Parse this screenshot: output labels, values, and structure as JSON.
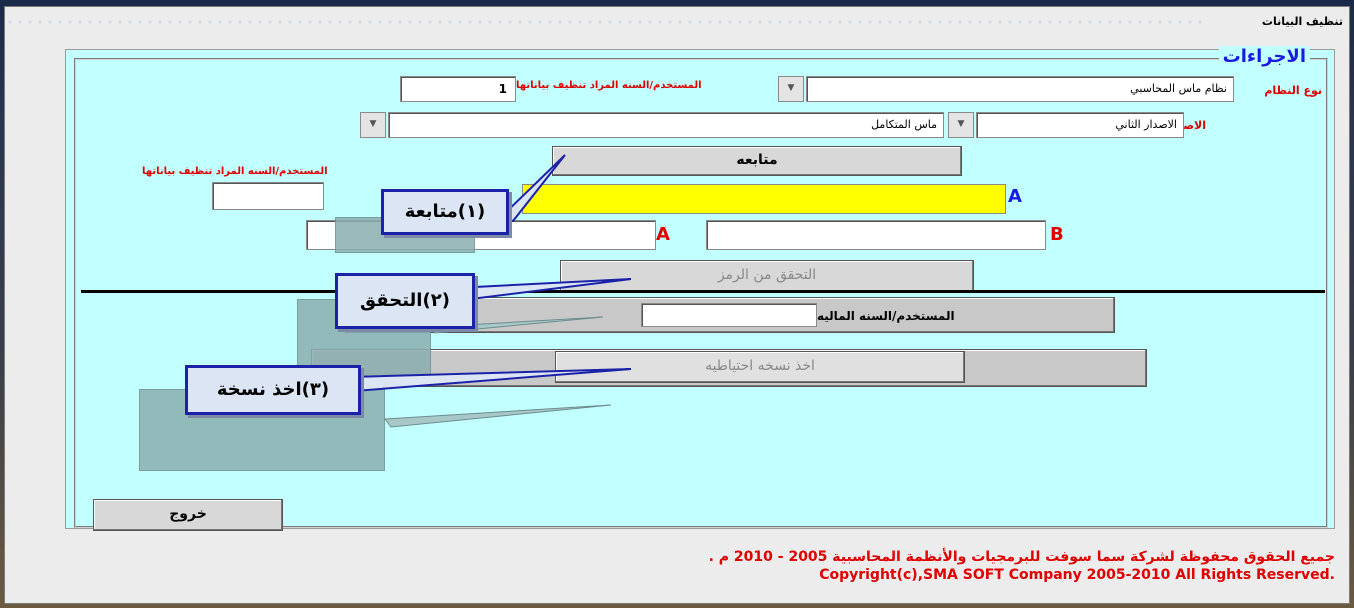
{
  "window": {
    "title": "تنظيف البيانات"
  },
  "procedures": {
    "title": "الاجراءات",
    "system_type_label": "نوع النظام",
    "system_type_value": "نظام ماس المحاسبي",
    "user_year_label": "المستخدم/السنه المراد تنظيف بياناتها",
    "user_year_value": "1",
    "version_label": "الاصدار",
    "version_value": "الاصدار الثاني",
    "edition_value": "ماس المتكامل",
    "continue_button": "متابعه",
    "user_year_label_2": "المستخدم/السنه المراد تنظيف بياناتها",
    "verify_button": "التحقق من الرمز",
    "user_fin_year_label": "المستخدم/السنه الماليه",
    "backup_button": "اخذ نسخه احتياطيه",
    "exit_button": "خروج",
    "letter_a": "A",
    "letter_b": "B"
  },
  "callouts": {
    "step1": "(١)متابعة",
    "step2": "(٢)التحقق",
    "step3": "(٣)اخذ نسخة"
  },
  "footer": {
    "copyright_ar": "جميع الحقوق محفوظة لشركة سما سوفت للبرمجيات والأنظمة المحاسبية  2005 - 2010 م .",
    "copyright_en": "Copyright(c),SMA SOFT Company 2005-2010 All Rights Reserved."
  },
  "colors": {
    "panel": "#c2ffff",
    "label_red": "#e00000",
    "accent_blue": "#1a1ae0",
    "highlight_yellow": "#ffff00"
  }
}
